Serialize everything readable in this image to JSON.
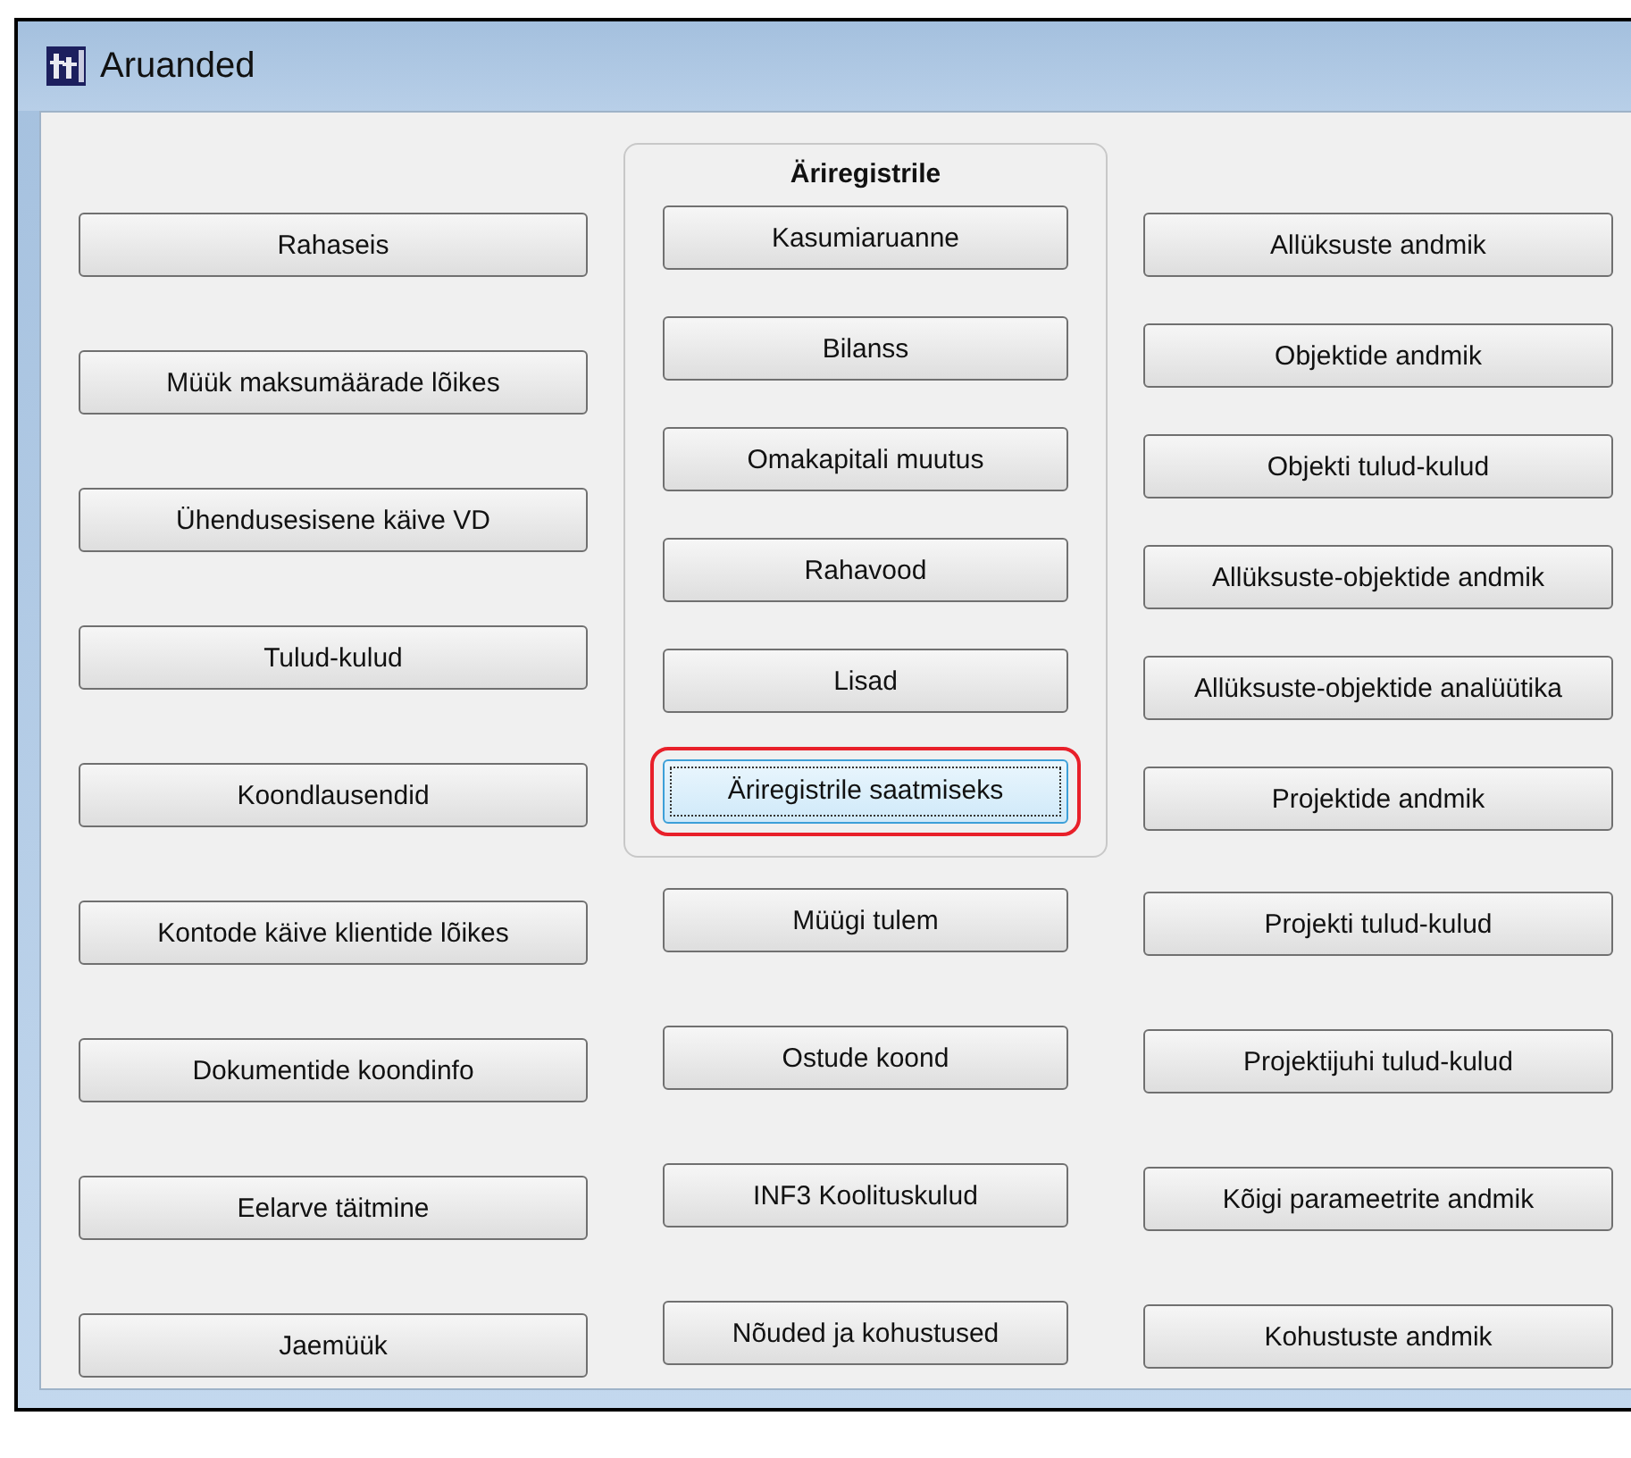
{
  "window": {
    "title": "Aruanded"
  },
  "left_column": [
    {
      "label": "Rahaseis",
      "focused": false
    },
    {
      "label": "Müük maksumäärade lõikes",
      "focused": false
    },
    {
      "label": "Ühendusesisene käive VD",
      "focused": false
    },
    {
      "label": "Tulud-kulud",
      "focused": false
    },
    {
      "label": "Koondlausendid",
      "focused": false
    },
    {
      "label": "Kontode käive klientide lõikes",
      "focused": false
    },
    {
      "label": "Dokumentide koondinfo",
      "focused": false
    },
    {
      "label": "Eelarve täitmine",
      "focused": false
    },
    {
      "label": "Jaemüük",
      "focused": false
    }
  ],
  "register_group": {
    "title": "Äriregistrile",
    "buttons": [
      {
        "label": "Kasumiaruanne",
        "focused": false
      },
      {
        "label": "Bilanss",
        "focused": false
      },
      {
        "label": "Omakapitali muutus",
        "focused": false
      },
      {
        "label": "Rahavood",
        "focused": false
      },
      {
        "label": "Lisad",
        "focused": false
      },
      {
        "label": "Äriregistrile saatmiseks",
        "focused": true
      }
    ]
  },
  "middle_column": [
    {
      "label": "Müügi tulem",
      "focused": false
    },
    {
      "label": "Ostude koond",
      "focused": false
    },
    {
      "label": "INF3 Koolituskulud",
      "focused": false
    },
    {
      "label": "Nõuded ja kohustused",
      "focused": false
    }
  ],
  "right_column": [
    {
      "label": "Allüksuste andmik",
      "focused": false
    },
    {
      "label": "Objektide andmik",
      "focused": false
    },
    {
      "label": "Objekti tulud-kulud",
      "focused": false
    },
    {
      "label": "Allüksuste-objektide andmik",
      "focused": false
    },
    {
      "label": "Allüksuste-objektide analüütika",
      "focused": false
    },
    {
      "label": "Projektide andmik",
      "focused": false
    },
    {
      "label": "Projekti tulud-kulud",
      "focused": false
    },
    {
      "label": "Projektijuhi tulud-kulud",
      "focused": false
    },
    {
      "label": "Kõigi parameetrite andmik",
      "focused": false
    },
    {
      "label": "Kohustuste andmik",
      "focused": false
    }
  ]
}
